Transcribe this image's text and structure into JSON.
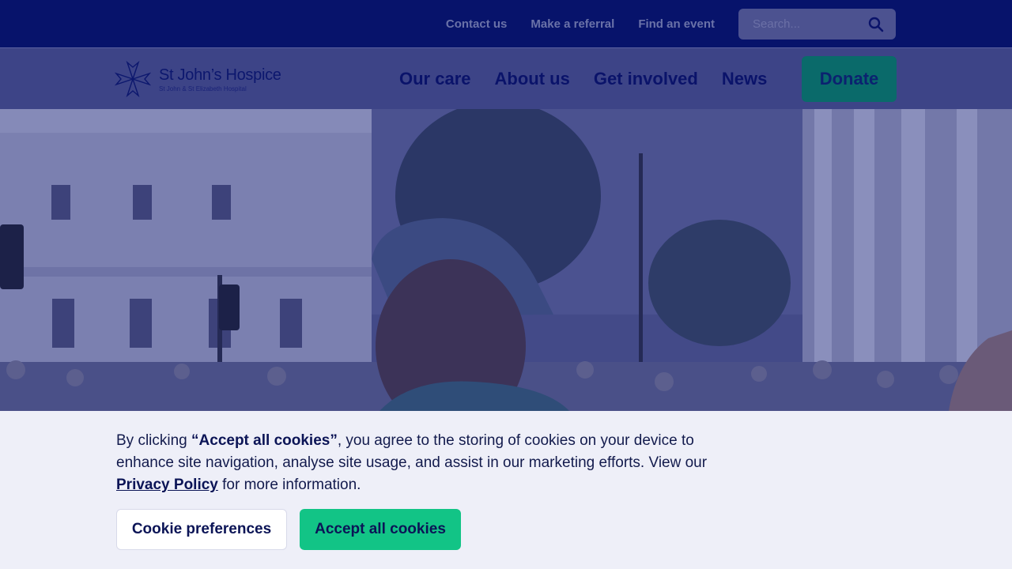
{
  "topbar": {
    "links": [
      "Contact us",
      "Make a referral",
      "Find an event"
    ],
    "search": {
      "placeholder": "Search...",
      "icon": "search-icon"
    }
  },
  "nav": {
    "logo": {
      "title": "St John’s Hospice",
      "subtitle": "St John & St Elizabeth Hospital"
    },
    "links": [
      "Our care",
      "About us",
      "Get involved",
      "News"
    ],
    "donate_label": "Donate"
  },
  "cookie": {
    "text_before": "By clicking ",
    "text_bold": "“Accept all cookies”",
    "text_middle": ", you agree to the storing of cookies on your device to enhance site navigation, analyse site usage, and assist in our marketing efforts. View our ",
    "link_label": "Privacy Policy",
    "text_after": " for more information.",
    "preferences_label": "Cookie preferences",
    "accept_label": "Accept all cookies"
  },
  "colors": {
    "topbar": "#07136b",
    "nav": "#3d4487",
    "donate": "#0a6a6a",
    "accept": "#12c486",
    "banner": "#eeeff8"
  }
}
